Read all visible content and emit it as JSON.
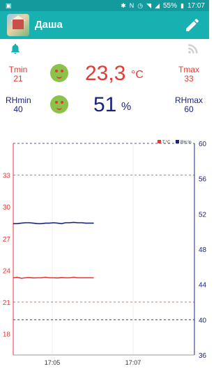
{
  "status_bar": {
    "time": "17:07",
    "battery": "55%"
  },
  "app_bar": {
    "title": "Даша"
  },
  "temperature": {
    "min_label": "Tmin",
    "min_value": "21",
    "max_label": "Tmax",
    "max_value": "33",
    "value": "23,3",
    "unit": "°C"
  },
  "humidity": {
    "min_label": "RHmin",
    "min_value": "40",
    "max_label": "RHmax",
    "max_value": "60",
    "value": "51",
    "unit": "%"
  },
  "icons": {
    "bell": "bell-icon",
    "rss": "rss-icon",
    "edit": "pencil-icon",
    "face": "smiley-face-icon"
  },
  "colors": {
    "accent": "#17b1b1",
    "temp": "#e53935",
    "humidity": "#1a237e"
  },
  "chart_data": {
    "type": "line",
    "legend": [
      "T,°C",
      "RH,%"
    ],
    "legend_position": "top-right",
    "x_ticks": [
      "17:05",
      "17:07"
    ],
    "left_axis": {
      "ticks": [
        18,
        21,
        24,
        27,
        30,
        33
      ],
      "range": [
        16,
        36
      ],
      "color": "#e53935"
    },
    "right_axis": {
      "ticks": [
        36,
        40,
        44,
        48,
        52,
        56,
        60
      ],
      "range": [
        36,
        60
      ],
      "color": "#1a237e"
    },
    "reference_lines": [
      {
        "axis": "left",
        "value": 33,
        "color": "#e53935"
      },
      {
        "axis": "left",
        "value": 21,
        "color": "#e53935"
      },
      {
        "axis": "right",
        "value": 60,
        "color": "#1a237e"
      },
      {
        "axis": "right",
        "value": 40,
        "color": "#1a237e"
      }
    ],
    "series": [
      {
        "name": "T,°C",
        "axis": "left",
        "color": "#e53935",
        "x": [
          0,
          0.1,
          0.2,
          0.3,
          0.4,
          0.5,
          0.6,
          0.7,
          0.8,
          0.9,
          1.0,
          1.1,
          1.2,
          1.3,
          1.4,
          1.5,
          1.6,
          1.7,
          1.8,
          1.9,
          2.0
        ],
        "y": [
          23.3,
          23.35,
          23.25,
          23.3,
          23.32,
          23.28,
          23.3,
          23.3,
          23.35,
          23.3,
          23.3,
          23.28,
          23.32,
          23.3,
          23.3,
          23.35,
          23.3,
          23.3,
          23.3,
          23.3,
          23.3
        ]
      },
      {
        "name": "RH,%",
        "axis": "right",
        "color": "#1a237e",
        "x": [
          0,
          0.1,
          0.2,
          0.3,
          0.4,
          0.5,
          0.6,
          0.7,
          0.8,
          0.9,
          1.0,
          1.1,
          1.2,
          1.3,
          1.4,
          1.5,
          1.6,
          1.7,
          1.8,
          1.9,
          2.0
        ],
        "y": [
          50.9,
          50.9,
          50.95,
          51.0,
          51.0,
          50.95,
          50.9,
          50.9,
          50.95,
          50.95,
          51.0,
          50.95,
          50.9,
          51.0,
          51.0,
          51.05,
          51.0,
          51.0,
          50.95,
          50.95,
          50.95
        ]
      }
    ]
  }
}
